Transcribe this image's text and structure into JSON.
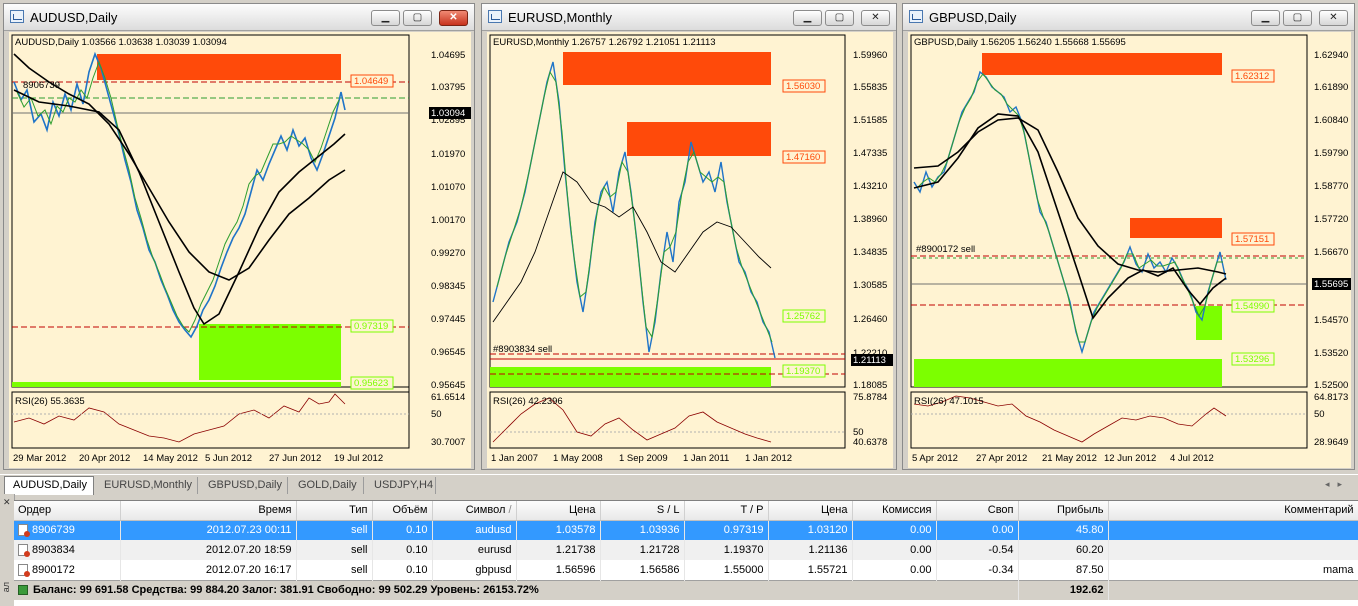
{
  "windows": [
    {
      "title": "AUDUSD,Daily",
      "header": "AUDUSD,Daily  1.03566 1.03638 1.03039 1.03094",
      "prices": [
        "1.04695",
        "1.03795",
        "1.02895",
        "1.01970",
        "1.01070",
        "1.00170",
        "0.99270",
        "0.98345",
        "0.97445",
        "0.96545",
        "0.95645"
      ],
      "current_price": "1.03094",
      "zone_labels": [
        "1.04649",
        "0.97319",
        "0.95623"
      ],
      "order_label": "8906739",
      "rsi_label": "RSI(26) 55.3635",
      "rsi_scale": [
        "61.6514",
        "50",
        "30.7007"
      ],
      "dates": [
        "29 Mar 2012",
        "20 Apr 2012",
        "14 May 2012",
        "5 Jun 2012",
        "27 Jun 2012",
        "19 Jul 2012"
      ]
    },
    {
      "title": "EURUSD,Monthly",
      "header": "EURUSD,Monthly  1.26757 1.26792 1.21051 1.21113",
      "prices": [
        "1.59960",
        "1.55835",
        "1.51585",
        "1.47335",
        "1.43210",
        "1.38960",
        "1.34835",
        "1.30585",
        "1.26460",
        "1.22210",
        "1.18085"
      ],
      "current_price": "1.21113",
      "zone_labels": [
        "1.56030",
        "1.47160",
        "1.25762",
        "1.19370"
      ],
      "order_label": "#8903834 sell",
      "rsi_label": "RSI(26) 42.2396",
      "rsi_scale": [
        "75.8784",
        "50",
        "40.6378"
      ],
      "dates": [
        "1 Jan 2007",
        "1 May 2008",
        "1 Sep 2009",
        "1 Jan 2011",
        "1 Jan 2012"
      ]
    },
    {
      "title": "GBPUSD,Daily",
      "header": "GBPUSD,Daily  1.56205 1.56240 1.55668 1.55695",
      "prices": [
        "1.62940",
        "1.61890",
        "1.60840",
        "1.59790",
        "1.58770",
        "1.57720",
        "1.56670",
        "1.55695",
        "1.54570",
        "1.53520",
        "1.52500"
      ],
      "current_price": "1.55695",
      "zone_labels": [
        "1.62312",
        "1.57151",
        "1.54990",
        "1.53296"
      ],
      "order_label": "#8900172 sell",
      "rsi_label": "RSI(26) 47.1015",
      "rsi_scale": [
        "64.8173",
        "50",
        "28.9649"
      ],
      "dates": [
        "5 Apr 2012",
        "27 Apr 2012",
        "21 May 2012",
        "12 Jun 2012",
        "4 Jul 2012"
      ]
    }
  ],
  "tabs": [
    "AUDUSD,Daily",
    "EURUSD,Monthly",
    "GBPUSD,Daily",
    "GOLD,Daily",
    "USDJPY,H4"
  ],
  "terminal": {
    "columns": [
      "Ордер",
      "Время",
      "Тип",
      "Объём",
      "Символ",
      "Цена",
      "S / L",
      "T / P",
      "Цена",
      "Комиссия",
      "Своп",
      "Прибыль",
      "Комментарий"
    ],
    "sort_indicator": "/",
    "rows": [
      [
        "8906739",
        "2012.07.23 00:11",
        "sell",
        "0.10",
        "audusd",
        "1.03578",
        "1.03936",
        "0.97319",
        "1.03120",
        "0.00",
        "0.00",
        "45.80",
        ""
      ],
      [
        "8903834",
        "2012.07.20 18:59",
        "sell",
        "0.10",
        "eurusd",
        "1.21738",
        "1.21728",
        "1.19370",
        "1.21136",
        "0.00",
        "-0.54",
        "60.20",
        ""
      ],
      [
        "8900172",
        "2012.07.20 16:17",
        "sell",
        "0.10",
        "gbpusd",
        "1.56596",
        "1.56586",
        "1.55000",
        "1.55721",
        "0.00",
        "-0.34",
        "87.50",
        "mama"
      ]
    ],
    "balance": "Баланс: 99 691.58  Средства: 99 884.20  Залог: 381.91  Свободно: 99 502.29  Уровень: 26153.72%",
    "total_profit": "192.62",
    "side_label": "ал"
  },
  "colors": {
    "chart_bg": "#fff3d2",
    "candle_bull": "#2e9e2e",
    "candle_bear": "#1f74c8",
    "resistance": "#ff4a0a",
    "support": "#7cff00",
    "ma": "#000000",
    "rsi": "#8b0000",
    "selected_row": "#3399ff"
  }
}
